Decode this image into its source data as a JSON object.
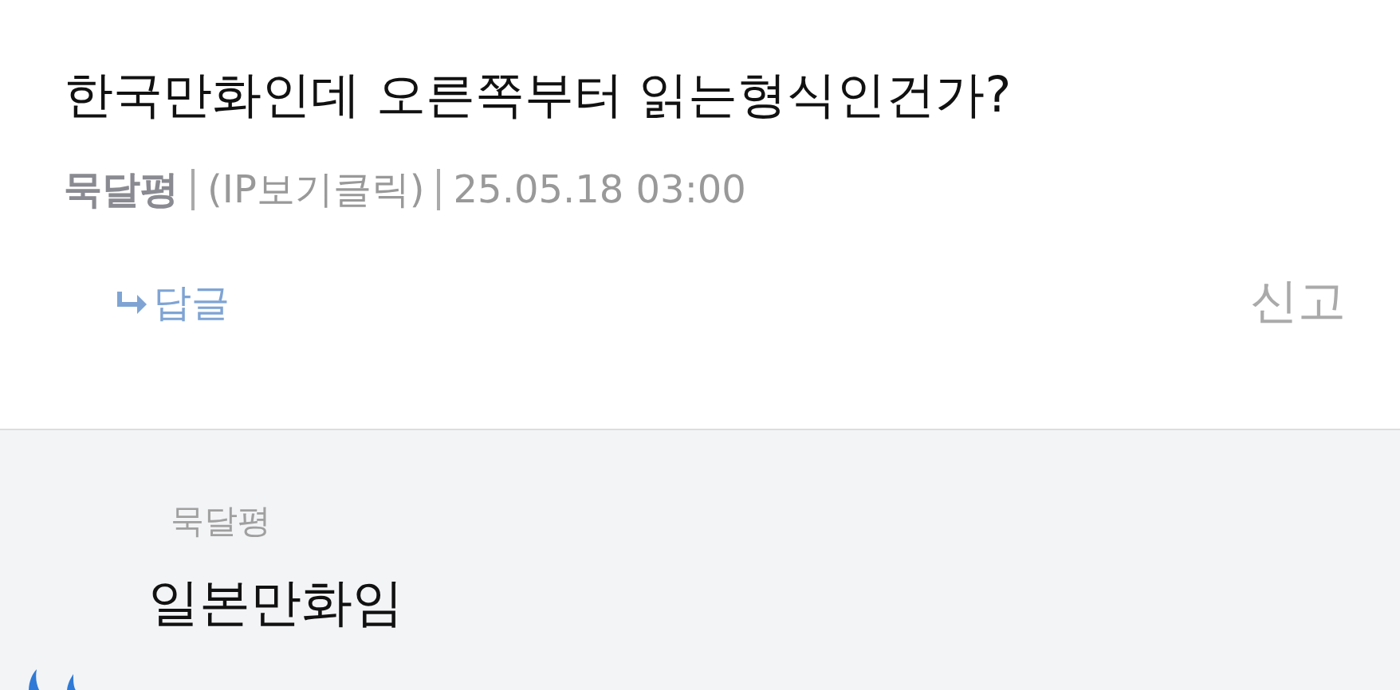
{
  "post": {
    "title": "한국만화인데 오른쪽부터 읽는형식인건가?",
    "author": "묵달평",
    "ip": "(IP보기클릭)",
    "date": "25.05.18 03:00",
    "reply": "답글",
    "report": "신고"
  },
  "comments": [
    {
      "author": "묵달평",
      "text": "일본만화임"
    }
  ]
}
